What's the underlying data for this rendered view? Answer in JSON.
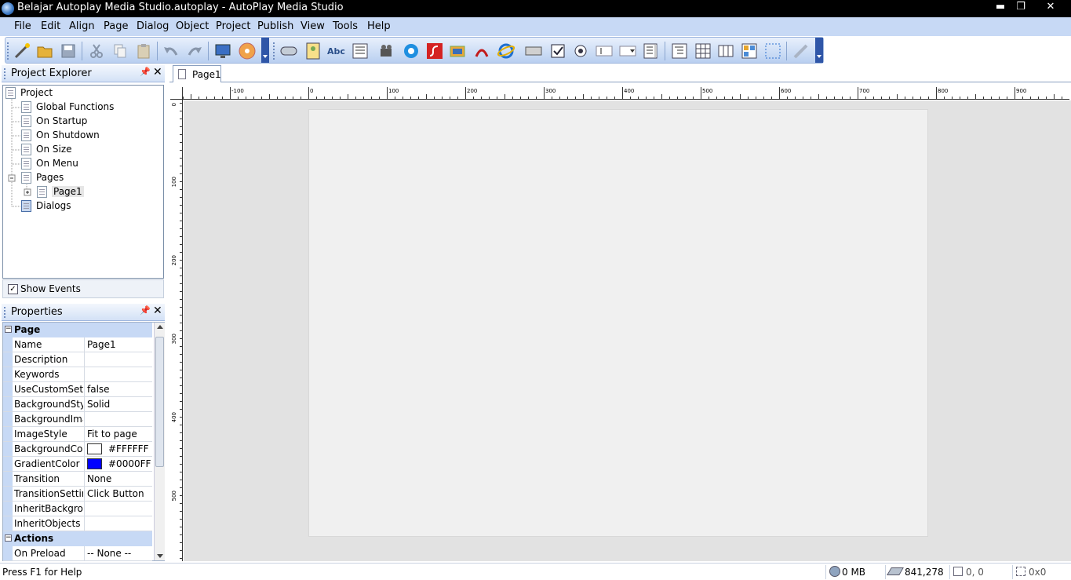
{
  "window": {
    "title": "Belajar Autoplay Media Studio.autoplay - AutoPlay Media Studio",
    "minimize_glyph": "▬",
    "restore_glyph": "❐",
    "close_glyph": "✕"
  },
  "menu": [
    "File",
    "Edit",
    "Align",
    "Page",
    "Dialog",
    "Object",
    "Project",
    "Publish",
    "View",
    "Tools",
    "Help"
  ],
  "project_explorer": {
    "title": "Project Explorer",
    "tree": {
      "root": "Project",
      "global_functions": "Global Functions",
      "on_startup": "On Startup",
      "on_shutdown": "On Shutdown",
      "on_size": "On Size",
      "on_menu": "On Menu",
      "pages": "Pages",
      "page1": "Page1",
      "dialogs": "Dialogs"
    },
    "show_events_label": "Show Events",
    "show_events_checked": true
  },
  "properties": {
    "title": "Properties",
    "cat_page": "Page",
    "cat_actions": "Actions",
    "rows": [
      {
        "name": "Name",
        "value": "Page1"
      },
      {
        "name": "Description",
        "value": ""
      },
      {
        "name": "Keywords",
        "value": ""
      },
      {
        "name": "UseCustomSettings",
        "value": "false"
      },
      {
        "name": "BackgroundStyle",
        "value": "Solid"
      },
      {
        "name": "BackgroundImage",
        "value": ""
      },
      {
        "name": "ImageStyle",
        "value": "Fit to page"
      },
      {
        "name": "BackgroundColor",
        "value": "#FFFFFF",
        "swatch": "#FFFFFF"
      },
      {
        "name": "GradientColor",
        "value": "#0000FF",
        "swatch": "#0000FF"
      },
      {
        "name": "Transition",
        "value": "None"
      },
      {
        "name": "TransitionSettings",
        "value": "Click Button"
      },
      {
        "name": "InheritBackground",
        "value": ""
      },
      {
        "name": "InheritObjects",
        "value": ""
      }
    ],
    "actions_rows": [
      {
        "name": "On Preload",
        "value": "-- None --"
      }
    ]
  },
  "editor": {
    "tab_label": "Page1",
    "hruler_labels": [
      "-100",
      "0",
      "100",
      "200",
      "300",
      "400",
      "500",
      "600",
      "700",
      "800",
      "900"
    ],
    "vruler_labels": [
      "0",
      "100",
      "200",
      "300",
      "400",
      "500"
    ]
  },
  "status": {
    "help_text": "Press F1 for Help",
    "memory": "0 MB",
    "cursor": "841,278",
    "position": "0, 0",
    "size": "0x0"
  }
}
